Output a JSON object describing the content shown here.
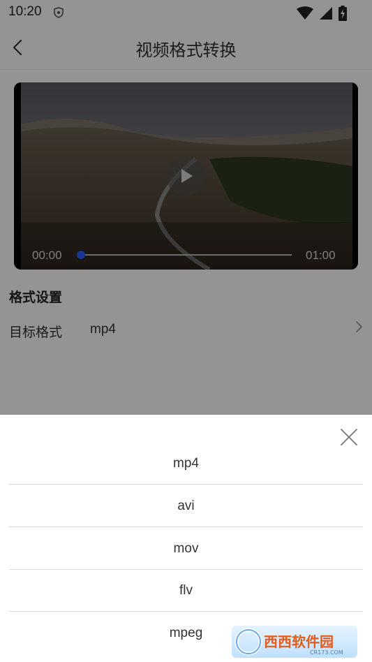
{
  "status_bar": {
    "time": "10:20",
    "icons": [
      "shield-icon",
      "wifi-icon",
      "cell-signal-icon",
      "battery-charging-icon"
    ]
  },
  "app_bar": {
    "title": "视频格式转换",
    "back_icon": "chevron-left-icon"
  },
  "player": {
    "current_time": "00:00",
    "duration": "01:00",
    "progress_fraction": 0,
    "play_icon": "play-icon",
    "accent_color": "#2a5cff"
  },
  "format_settings": {
    "section_title": "格式设置",
    "target_label": "目标格式",
    "target_value": "mp4"
  },
  "sheet": {
    "close_icon": "close-icon",
    "options": [
      "mp4",
      "avi",
      "mov",
      "flv",
      "mpeg"
    ]
  },
  "watermark": {
    "text": "西西软件园",
    "sub_text": "CR173.COM"
  }
}
